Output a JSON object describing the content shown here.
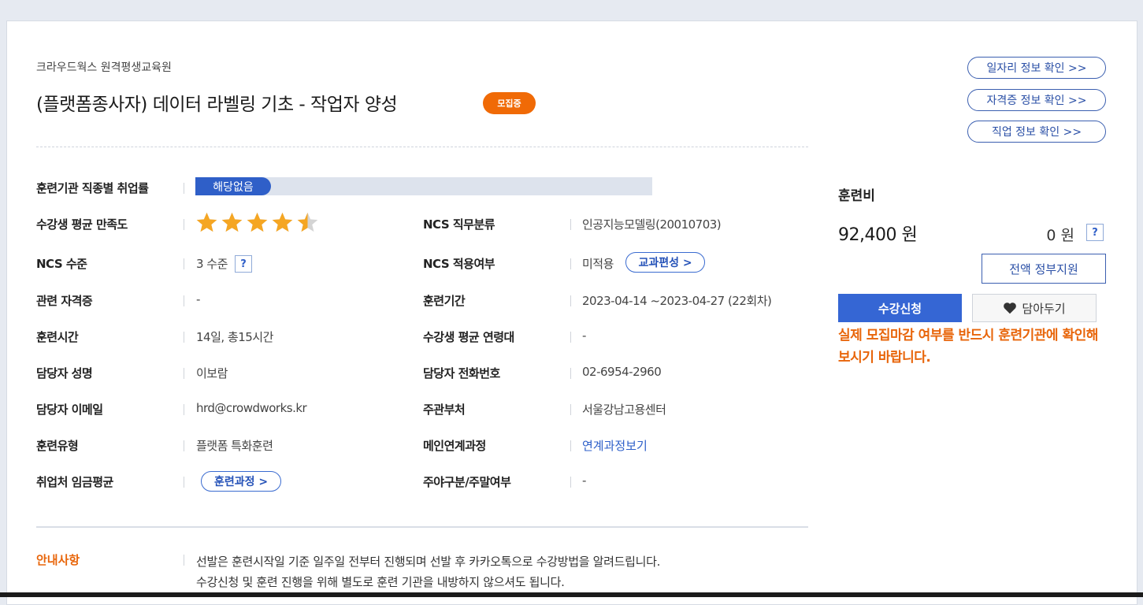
{
  "header": {
    "organization": "크라우드웍스 원격평생교육원",
    "course_title": "(플랫폼종사자) 데이터 라벨링 기초 - 작업자 양성",
    "status_badge": "모집중"
  },
  "employment_rate": {
    "label": "훈련기관 직종별 취업률",
    "value": "해당없음"
  },
  "satisfaction": {
    "label": "수강생 평균 만족도",
    "stars": 4.5,
    "max_stars": 5,
    "star_color": "#f5a623"
  },
  "left_fields": {
    "ncs_level_label": "NCS 수준",
    "ncs_level_value": "3 수준",
    "help_mark": "?",
    "certificate_label": "관련 자격증",
    "certificate_value": "-",
    "training_time_label": "훈련시간",
    "training_time_value": "14일, 총15시간",
    "manager_name_label": "담당자 성명",
    "manager_name_value": "이보람",
    "manager_email_label": "담당자 이메일",
    "manager_email_value": "hrd@crowdworks.kr",
    "training_type_label": "훈련유형",
    "training_type_value": "플랫폼 특화훈련",
    "wage_label": "취업처 임금평균",
    "wage_link": "훈련과정 >"
  },
  "right_fields": {
    "ncs_class_label": "NCS 직무분류",
    "ncs_class_value": "인공지능모델링(20010703)",
    "ncs_apply_label": "NCS 적용여부",
    "ncs_apply_value": "미적용",
    "curriculum_link": "교과편성 >",
    "period_label": "훈련기간",
    "period_value": "2023-04-14 ~2023-04-27 (22회차)",
    "age_label": "수강생 평균 연령대",
    "age_value": "-",
    "phone_label": "담당자 전화번호",
    "phone_value": "02-6954-2960",
    "agency_label": "주관부처",
    "agency_value": "서울강남고용센터",
    "main_course_label": "메인연계과정",
    "main_course_link": "연계과정보기",
    "daynight_label": "주야구분/주말여부",
    "daynight_value": "-"
  },
  "sidebar": {
    "job_info": "일자리 정보 확인 >>",
    "cert_info": "자격증 정보 확인 >>",
    "occupation_info": "직업 정보 확인 >>",
    "fee_label": "훈련비",
    "fee_value": "92,400 원",
    "self_pay": "0 원",
    "help_mark": "?",
    "gov_support": "전액 정부지원",
    "apply": "수강신청",
    "wishlist": "담아두기",
    "warning": "실제 모집마감 여부를 반드시 훈련기관에 확인해보시기 바랍니다."
  },
  "notice": {
    "label": "안내사항",
    "line1": "선발은 훈련시작일 기준 일주일 전부터 진행되며 선발 후 카카오톡으로 수강방법을 알려드립니다.",
    "line2": "수강신청 및 훈련 진행을 위해 별도로 훈련 기관을 내방하지 않으셔도 됩니다."
  },
  "colors": {
    "accent_orange": "#f06a06",
    "primary_blue": "#3566d4",
    "link_blue": "#2d5fc9"
  }
}
